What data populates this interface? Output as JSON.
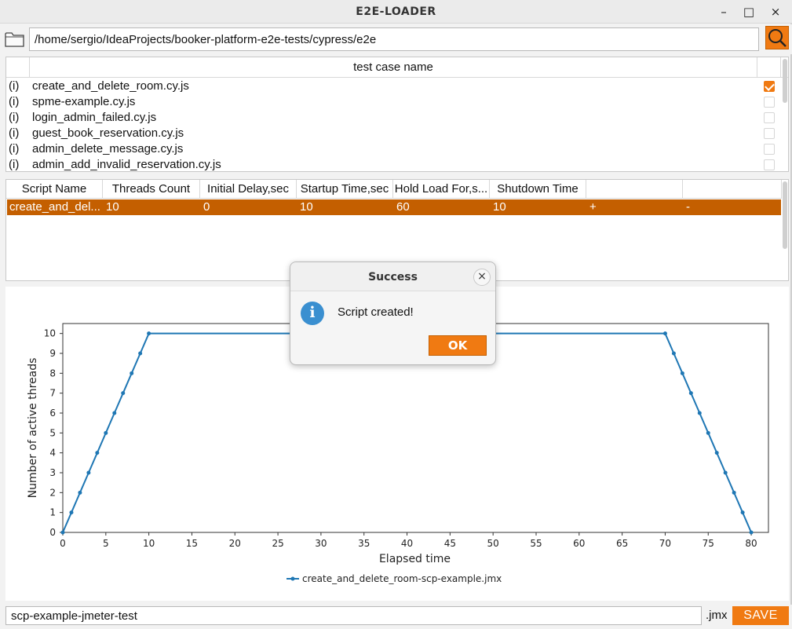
{
  "window": {
    "title": "E2E-LOADER",
    "minimize_glyph": "–",
    "maximize_glyph": "□",
    "close_glyph": "×"
  },
  "pathbar": {
    "path_value": "/home/sergio/IdeaProjects/booker-platform-e2e-tests/cypress/e2e",
    "folder_icon": "folder-icon",
    "search_icon": "search-icon"
  },
  "tests": {
    "header": "test case name",
    "rows": [
      {
        "marker": "(i)",
        "name": "create_and_delete_room.cy.js",
        "checked": true
      },
      {
        "marker": "(i)",
        "name": "spme-example.cy.js",
        "checked": false
      },
      {
        "marker": "(i)",
        "name": "login_admin_failed.cy.js",
        "checked": false
      },
      {
        "marker": "(i)",
        "name": "guest_book_reservation.cy.js",
        "checked": false
      },
      {
        "marker": "(i)",
        "name": "admin_delete_message.cy.js",
        "checked": false
      },
      {
        "marker": "(i)",
        "name": "admin_add_invalid_reservation.cy.js",
        "checked": false
      }
    ]
  },
  "scripts": {
    "headers": [
      "Script Name",
      "Threads Count",
      "Initial Delay,sec",
      "Startup Time,sec",
      "Hold Load For,s...",
      "Shutdown Time",
      "",
      ""
    ],
    "row": [
      "create_and_del...",
      "10",
      "0",
      "10",
      "60",
      "10",
      "+",
      "-"
    ]
  },
  "chart_data": {
    "type": "line",
    "title": "",
    "xlabel": "Elapsed time",
    "ylabel": "Number of active threads",
    "xlim": [
      0,
      82
    ],
    "ylim": [
      0,
      10.5
    ],
    "xticks": [
      0,
      5,
      10,
      15,
      20,
      25,
      30,
      35,
      40,
      45,
      50,
      55,
      60,
      65,
      70,
      75,
      80
    ],
    "yticks": [
      0,
      1,
      2,
      3,
      4,
      5,
      6,
      7,
      8,
      9,
      10
    ],
    "grid": false,
    "legend_position": "bottom-center",
    "series": [
      {
        "name": "create_and_delete_room-scp-example.jmx",
        "color": "#1f77b4",
        "x": [
          0,
          1,
          2,
          3,
          4,
          5,
          6,
          7,
          8,
          9,
          10,
          70,
          71,
          72,
          73,
          74,
          75,
          76,
          77,
          78,
          79,
          80
        ],
        "y": [
          0,
          1,
          2,
          3,
          4,
          5,
          6,
          7,
          8,
          9,
          10,
          10,
          9,
          8,
          7,
          6,
          5,
          4,
          3,
          2,
          1,
          0
        ]
      }
    ]
  },
  "dialog": {
    "title": "Success",
    "message": "Script created!",
    "ok_label": "OK",
    "close_glyph": "×",
    "icon": "info-icon"
  },
  "bottombar": {
    "name_value": "scp-example-jmeter-test",
    "extension": ".jmx",
    "save_label": "SAVE"
  },
  "colors": {
    "accent": "#f07a12",
    "selected_row": "#c45f00",
    "info_blue": "#3a8fd0",
    "series_line": "#1f77b4"
  }
}
